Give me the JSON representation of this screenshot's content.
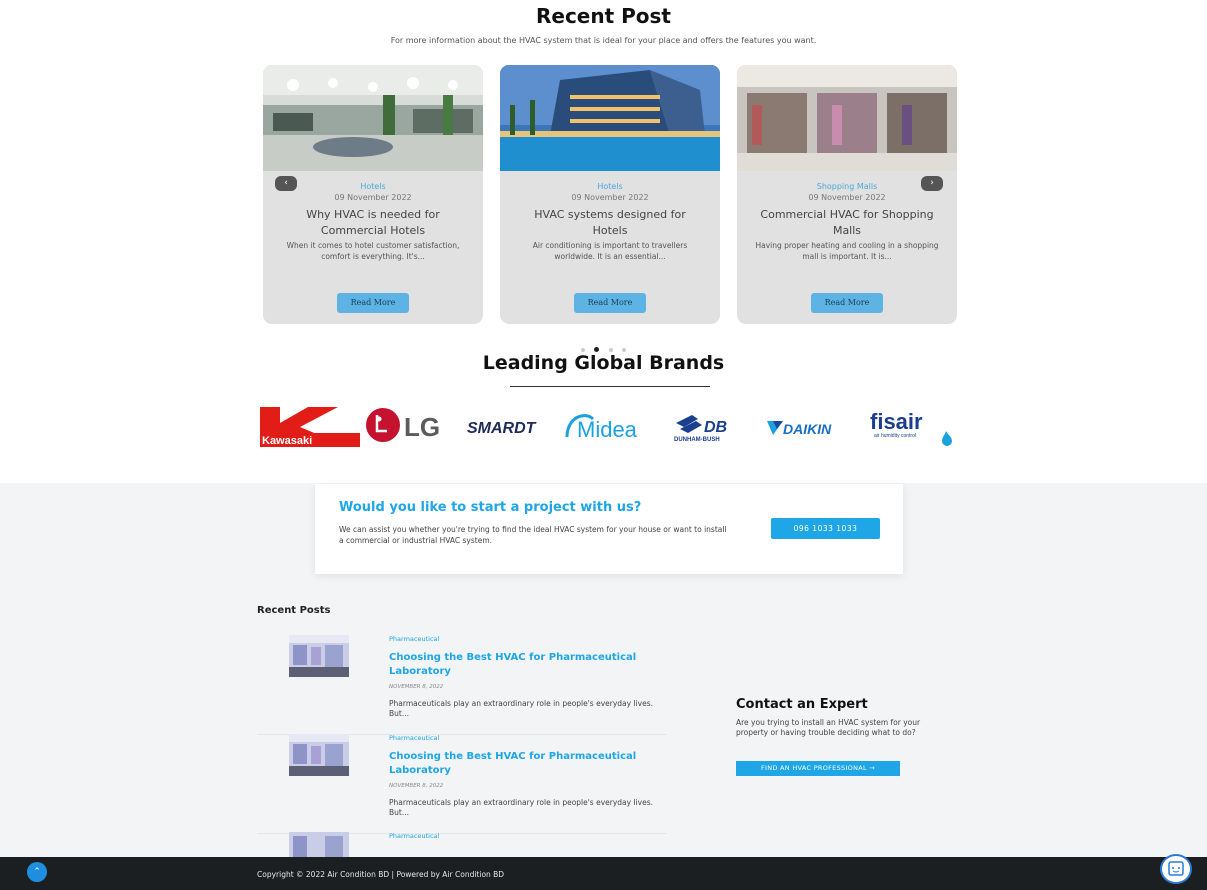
{
  "recent_post": {
    "title": "Recent Post",
    "subtitle": "For more information about the HVAC system that is ideal for your place and offers the features you want.",
    "cards": [
      {
        "category": "Hotels",
        "date": "09 November 2022",
        "title": "Why HVAC is needed for Commercial Hotels",
        "excerpt": "When it comes to hotel customer satisfaction, comfort is everything. It's...",
        "button": "Read More"
      },
      {
        "category": "Hotels",
        "date": "09 November 2022",
        "title": "HVAC systems designed for Hotels",
        "excerpt": "Air conditioning is important to travellers worldwide. It is an essential...",
        "button": "Read More"
      },
      {
        "category": "Shopping Malls",
        "date": "09 November 2022",
        "title": "Commercial HVAC for Shopping Malls",
        "excerpt": "Having proper heating and cooling in a shopping mall is important. It is...",
        "button": "Read More"
      }
    ]
  },
  "brands": {
    "title": "Leading Global Brands",
    "items": [
      "Kawasaki",
      "LG",
      "SMARDT",
      "Midea",
      "DB",
      "DUNHAM-BUSH",
      "DAIKIN",
      "fisair",
      "air humidity control"
    ]
  },
  "cta": {
    "title": "Would you like to start a project with us?",
    "text": "We can assist you whether you're trying to find the ideal HVAC system for your house or want to install a commercial or industrial HVAC system.",
    "phone": "096 1033 1033"
  },
  "recent_posts": {
    "title": "Recent Posts",
    "items": [
      {
        "category": "Pharmaceutical",
        "title": "Choosing the Best HVAC for Pharmaceutical Laboratory",
        "date": "NOVEMBER 8, 2022",
        "excerpt": "Pharmaceuticals play an extraordinary role in people's everyday lives. But..."
      },
      {
        "category": "Pharmaceutical",
        "title": "Choosing the Best HVAC for Pharmaceutical Laboratory",
        "date": "NOVEMBER 8, 2022",
        "excerpt": "Pharmaceuticals play an extraordinary role in people's everyday lives. But..."
      },
      {
        "category": "Pharmaceutical"
      }
    ]
  },
  "contact_expert": {
    "title": "Contact an Expert",
    "text": "Are you trying to install an HVAC system for your property or having trouble deciding what to do?",
    "button": "FIND AN HVAC PROFESSIONAL →"
  },
  "footer": {
    "copyright": "Copyright © 2022 Air Condition BD | Powered by Air Condition BD"
  },
  "icons": {
    "prev": "chevron-left-icon",
    "next": "chevron-right-icon",
    "scroll_top": "chevron-up-icon",
    "chat": "chat-icon"
  },
  "colors": {
    "accent": "#1ea6e6",
    "card_bg": "#e1e1e1",
    "read_more_bg": "#5db4e4",
    "footer_bg": "#1c1f22",
    "section_bg": "#f2f4f5"
  }
}
